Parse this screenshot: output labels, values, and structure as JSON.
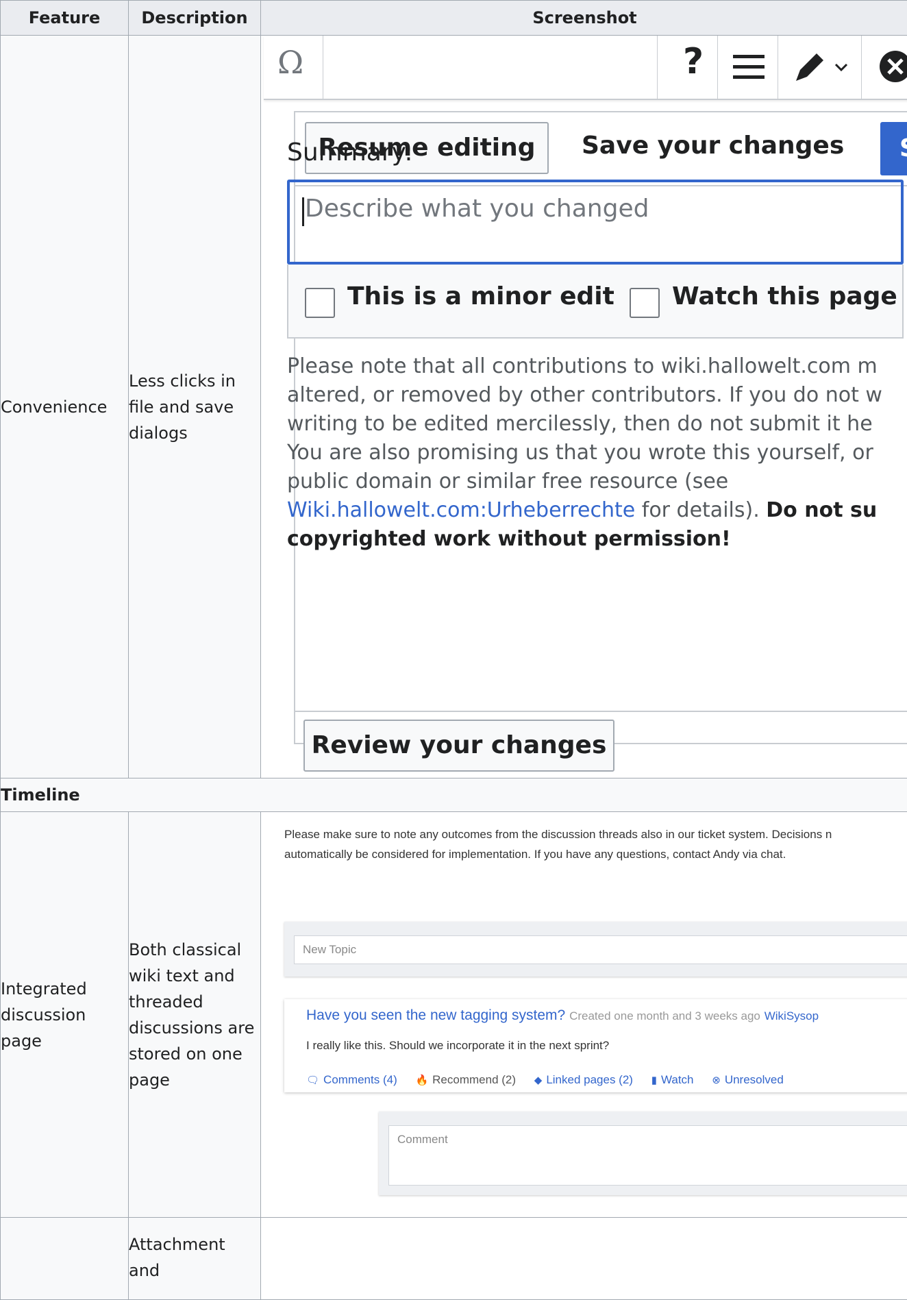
{
  "table": {
    "headers": [
      "Feature",
      "Description",
      "Screenshot"
    ],
    "rows": {
      "convenience": {
        "feature": "Convenience",
        "description": "Less clicks in file and save dialogs"
      },
      "timeline": {
        "section": "Timeline"
      },
      "discussion": {
        "feature": "Integrated discussion page",
        "description": "Both classical wiki text and threaded discussions are stored on one page"
      },
      "attachment": {
        "feature": "",
        "description": "Attachment and"
      }
    }
  },
  "save_dialog": {
    "toolbar": {
      "special_char_icon": "Ω",
      "help_icon": "?",
      "menu_icon": "hamburger-icon",
      "edit_mode_icon": "pencil-icon",
      "close_icon": "close-icon"
    },
    "resume_button": "Resume editing",
    "title": "Save your changes",
    "primary_button_glyph": "S",
    "summary_label": "Summary:",
    "summary_placeholder": "Describe what you changed",
    "minor_edit_label": "This is a minor edit",
    "watch_label": "Watch this page",
    "license_text_1": "Please note that all contributions to wiki.hallowelt.com m",
    "license_text_2": "altered, or removed by other contributors. If you do not w",
    "license_text_3": "writing to be edited mercilessly, then do not submit it he",
    "license_text_4": "You are also promising us that you wrote this yourself, or",
    "license_text_5": "public domain or similar free resource (see",
    "license_link": "Wiki.hallowelt.com:Urheberrechte",
    "license_text_6": " for details). ",
    "license_bold_1": "Do not su",
    "license_bold_2": "copyrighted work without permission!",
    "review_button": "Review your changes",
    "colors": {
      "accent": "#3366cc",
      "border": "#c8ccd1"
    }
  },
  "discussion": {
    "note_line_1": "Please make sure to note any outcomes from the discussion threads also in our ticket system. Decisions n",
    "note_line_2": "automatically be considered for implementation. If you have any questions, contact Andy via chat.",
    "new_topic_placeholder": "New Topic",
    "thread": {
      "title": "Have you seen the new tagging system?",
      "meta": "Created one month and 3 weeks ago",
      "author": "WikiSysop",
      "body": "I really like this. Should we incorporate it in the next sprint?",
      "actions": {
        "comments": "Comments (4)",
        "recommend": "Recommend (2)",
        "linked": "Linked pages (2)",
        "watch": "Watch",
        "unresolved": "Unresolved"
      }
    },
    "comment_placeholder": "Comment"
  }
}
